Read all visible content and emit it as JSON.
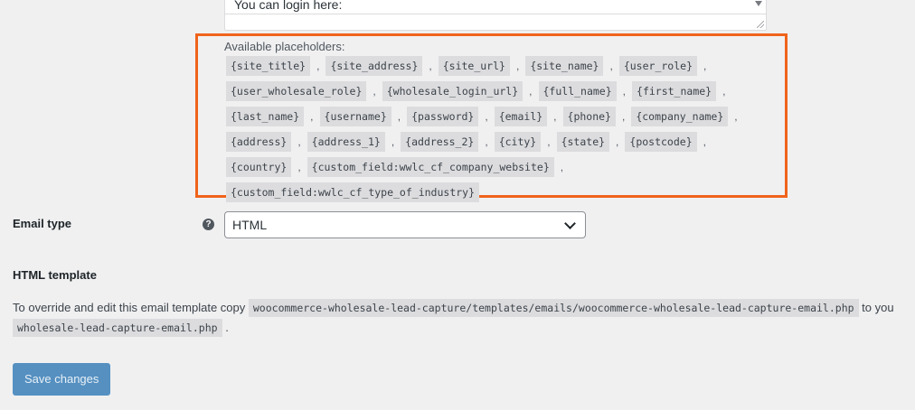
{
  "textarea": {
    "visible_text": "You can login here:"
  },
  "placeholders": {
    "title": "Available placeholders:",
    "items": [
      "{site_title}",
      "{site_address}",
      "{site_url}",
      "{site_name}",
      "{user_role}",
      "{user_wholesale_role}",
      "{wholesale_login_url}",
      "{full_name}",
      "{first_name}",
      "{last_name}",
      "{username}",
      "{password}",
      "{email}",
      "{phone}",
      "{company_name}",
      "{address}",
      "{address_1}",
      "{address_2}",
      "{city}",
      "{state}",
      "{postcode}",
      "{country}",
      "{custom_field:wwlc_cf_company_website}",
      "{custom_field:wwlc_cf_type_of_industry}"
    ],
    "separator": ",",
    "highlight_color": "#f0631b"
  },
  "email_type": {
    "label": "Email type",
    "help_icon": "?",
    "selected": "HTML"
  },
  "html_template": {
    "heading": "HTML template",
    "text_before": "To override and edit this email template copy",
    "path": "woocommerce-wholesale-lead-capture/templates/emails/woocommerce-wholesale-lead-capture-email.php",
    "text_after": "to you",
    "dest_file": "wholesale-lead-capture-email.php",
    "trailing": "."
  },
  "save_button": {
    "label": "Save changes",
    "color": "#2271b1"
  }
}
